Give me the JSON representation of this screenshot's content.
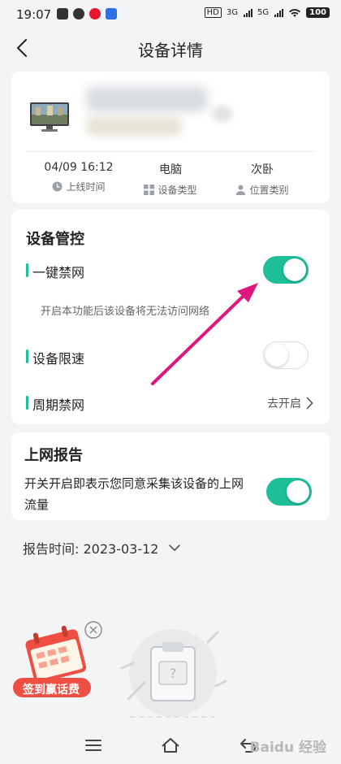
{
  "status_bar": {
    "time": "19:07",
    "hd": "HD",
    "net1": "3G",
    "net2": "5G",
    "battery": "100"
  },
  "nav": {
    "title": "设备详情"
  },
  "device": {
    "online_time": "04/09 16:12",
    "online_time_label": "上线时间",
    "device_type": "电脑",
    "device_type_label": "设备类型",
    "location": "次卧",
    "location_label": "位置类别"
  },
  "control": {
    "title": "设备管控",
    "one_key_block": {
      "label": "一键禁网",
      "enabled": true,
      "hint": "开启本功能后该设备将无法访问网络"
    },
    "speed_limit": {
      "label": "设备限速",
      "enabled": false
    },
    "period_block": {
      "label": "周期禁网",
      "action": "去开启"
    }
  },
  "report": {
    "title": "上网报告",
    "description": "开关开启即表示您同意采集该设备的上网流量",
    "enabled": true,
    "time_label": "报告时间: 2023-03-12"
  },
  "promo": {
    "label": "签到赢话费"
  },
  "watermark": "Baidu 经验",
  "colors": {
    "accent": "#1dbf99",
    "background": "#f2f4f5",
    "arrow": "#e0167f",
    "promo": "#ef4f43"
  }
}
